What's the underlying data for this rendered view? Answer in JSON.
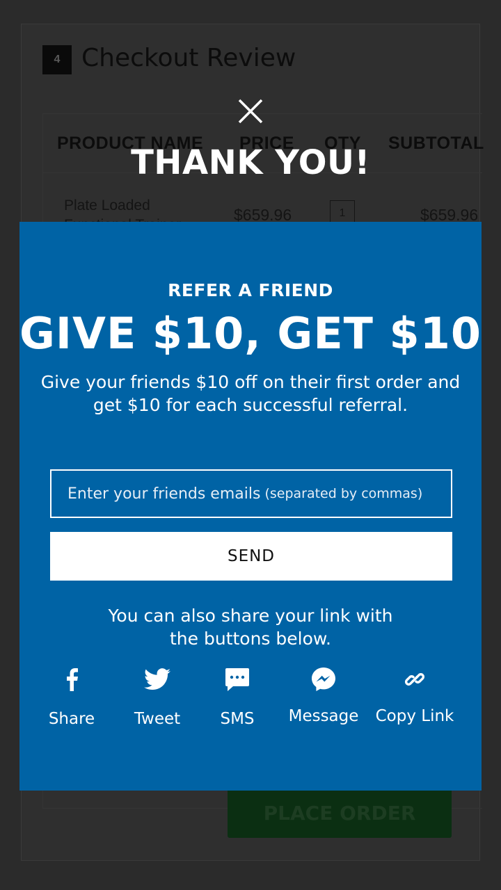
{
  "background": {
    "step_number": "4",
    "title": "Checkout Review",
    "table": {
      "headers": [
        "PRODUCT NAME",
        "PRICE",
        "QTY",
        "SUBTOTAL"
      ],
      "row": {
        "product": "Plate Loaded",
        "product_line2": "Functional Trainer",
        "price": "$659.96",
        "qty": "1",
        "subtotal": "$659.96"
      }
    },
    "place_order_label": "PLACE ORDER"
  },
  "modal": {
    "thank_you": "THANK YOU!",
    "kicker": "REFER A FRIEND",
    "headline": "GIVE $10, GET $10",
    "subtext": "Give your friends $10 off on their first order and get $10 for each successful referral.",
    "email_placeholder": "Enter your friends emails",
    "email_placeholder_hint": "(separated by commas)",
    "send_label": "SEND",
    "share_note_line1": "You can also share your link with",
    "share_note_line2": "the buttons below.",
    "share_buttons": [
      {
        "label": "Share",
        "icon": "facebook-icon"
      },
      {
        "label": "Tweet",
        "icon": "twitter-icon"
      },
      {
        "label": "SMS",
        "icon": "sms-icon"
      },
      {
        "label": "Message",
        "icon": "messenger-icon"
      },
      {
        "label": "Copy Link",
        "icon": "link-icon"
      }
    ]
  },
  "colors": {
    "overlay_bg": "#2b2b2b",
    "panel_blue": "#0063a5",
    "text_white": "#ffffff"
  }
}
